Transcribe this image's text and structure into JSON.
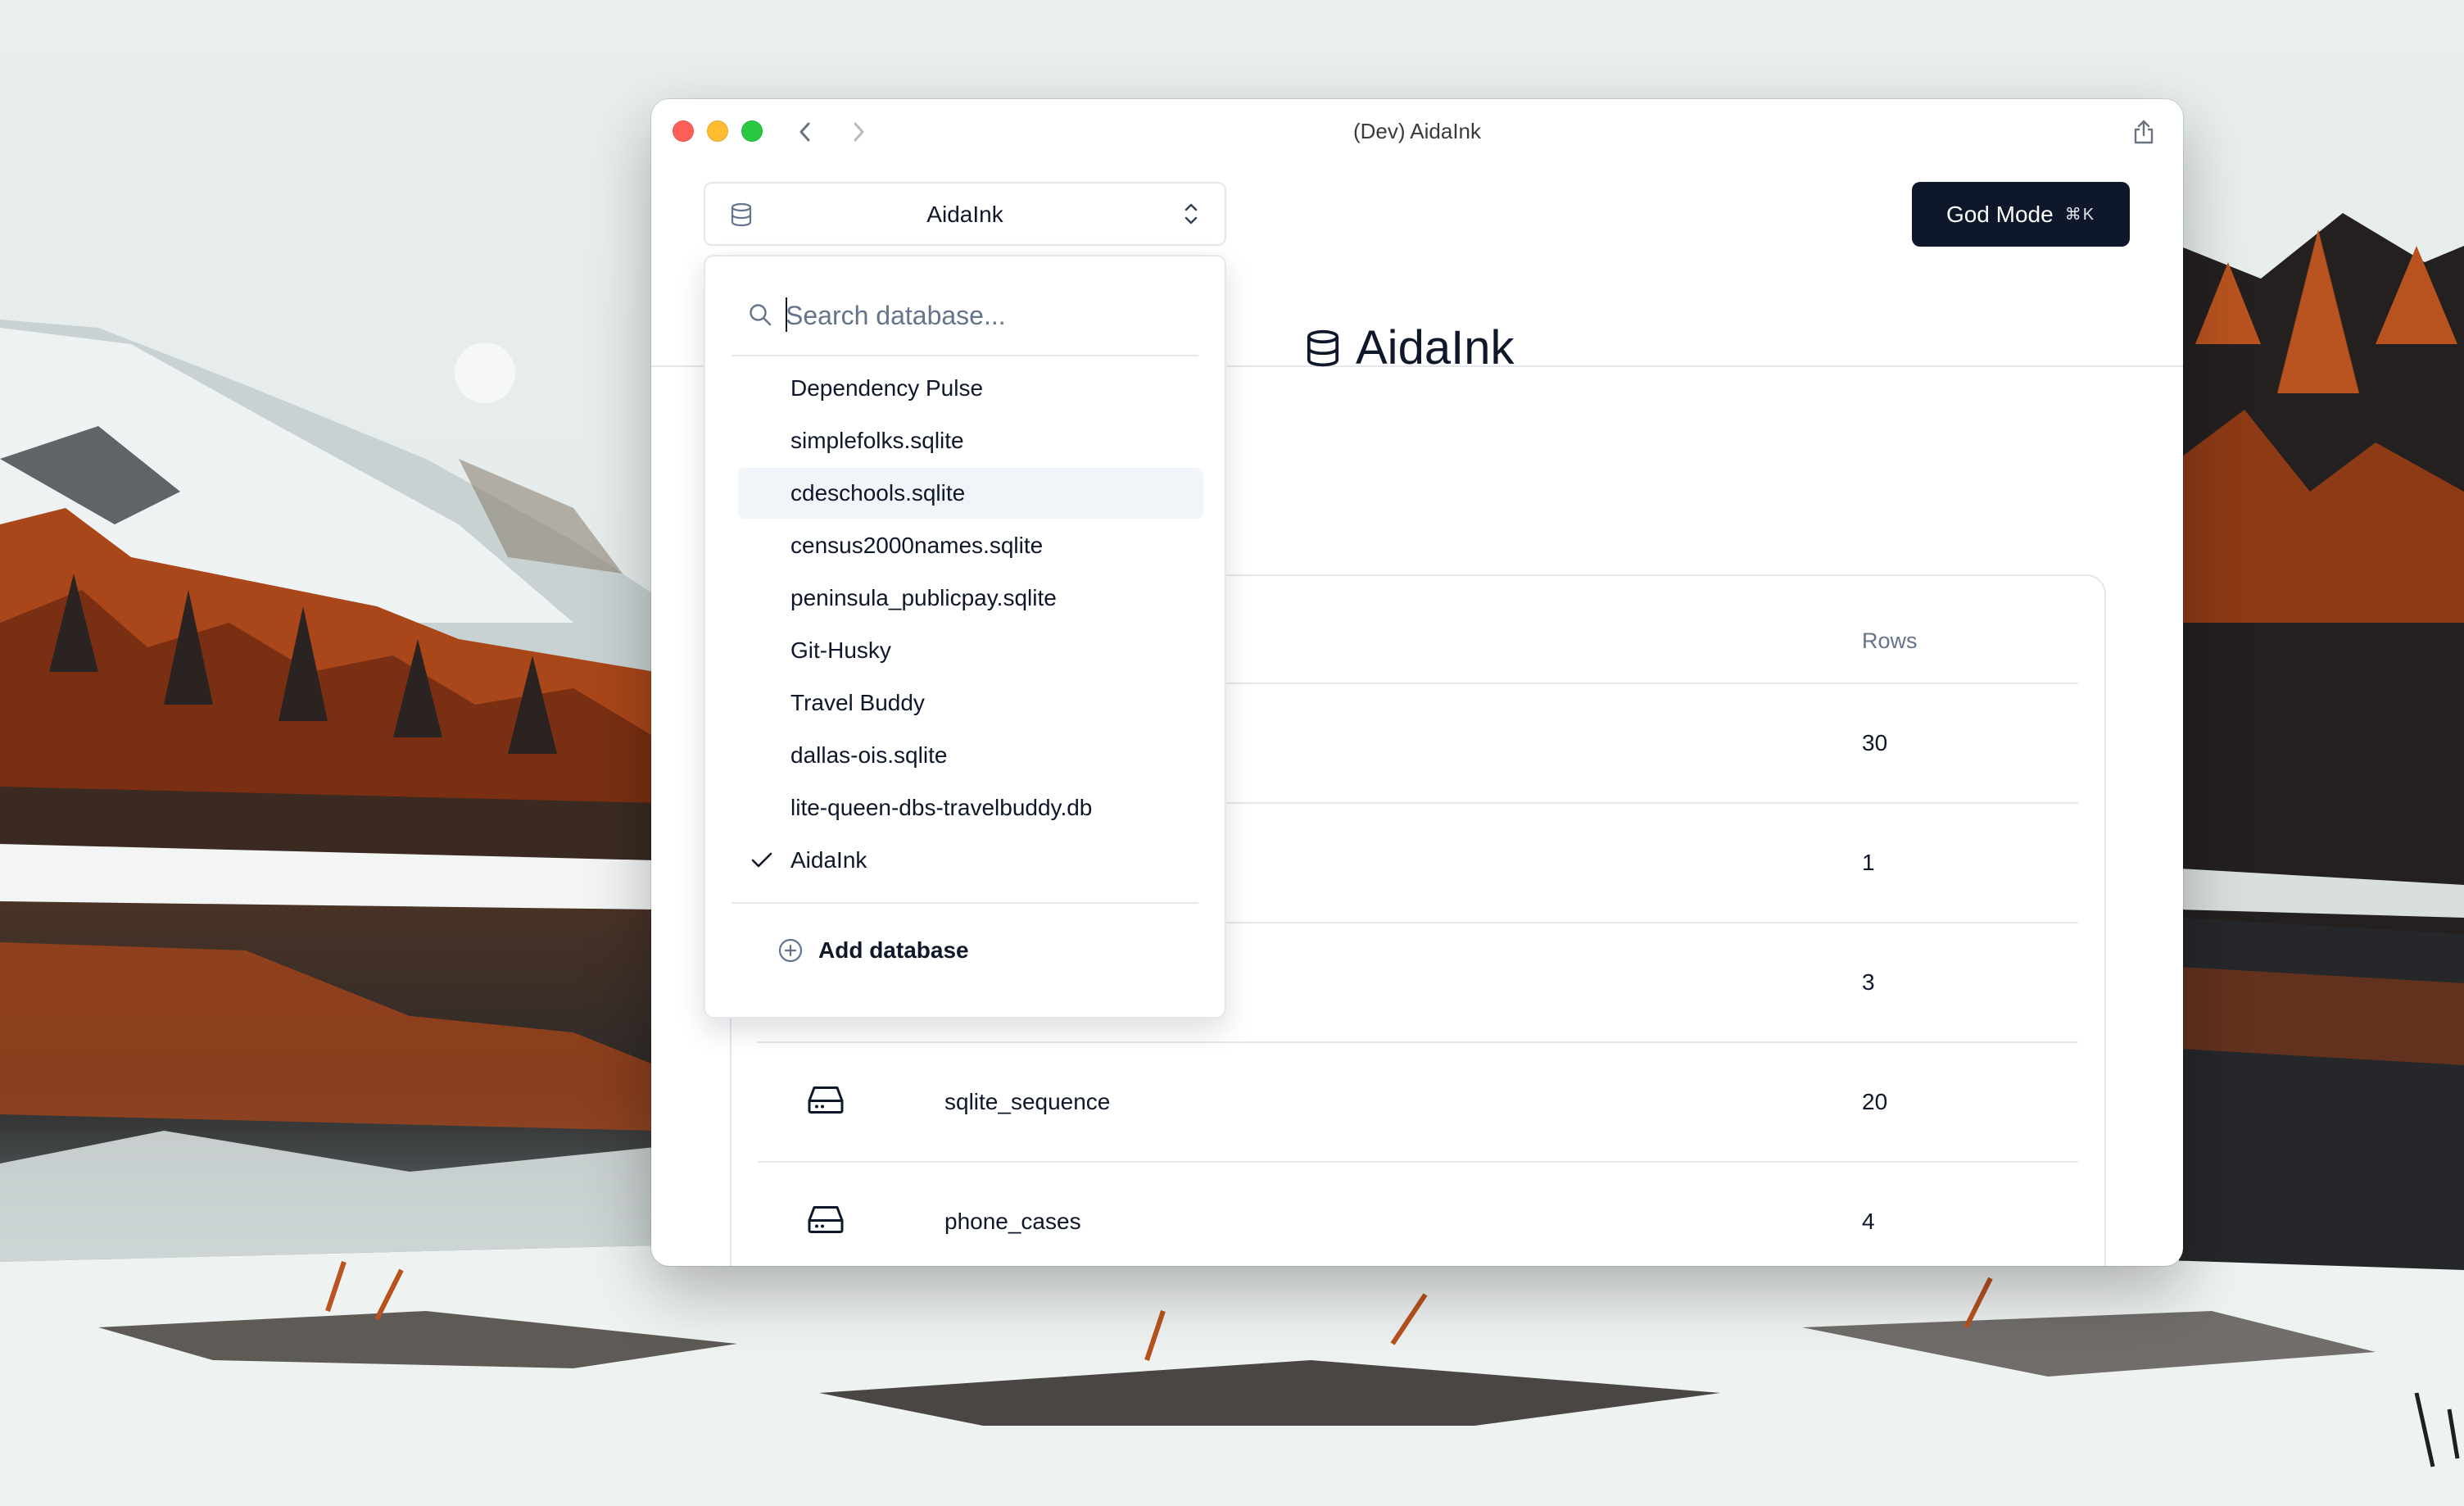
{
  "window": {
    "title": "(Dev) AidaInk"
  },
  "selector": {
    "current": "AidaInk",
    "icon": "database-icon"
  },
  "god_mode": {
    "label": "God Mode",
    "shortcut": "⌘K"
  },
  "page": {
    "title": "AidaInk"
  },
  "tables": {
    "rows_header": "Rows",
    "rows": [
      {
        "name": "",
        "count": "30"
      },
      {
        "name": "",
        "count": "1"
      },
      {
        "name": "",
        "count": "3"
      },
      {
        "name": "sqlite_sequence",
        "count": "20"
      },
      {
        "name": "phone_cases",
        "count": "4"
      }
    ]
  },
  "dropdown": {
    "search_placeholder": "Search database...",
    "items": [
      {
        "label": "Dependency Pulse",
        "selected": false,
        "highlighted": false
      },
      {
        "label": "simplefolks.sqlite",
        "selected": false,
        "highlighted": false
      },
      {
        "label": "cdeschools.sqlite",
        "selected": false,
        "highlighted": true
      },
      {
        "label": "census2000names.sqlite",
        "selected": false,
        "highlighted": false
      },
      {
        "label": "peninsula_publicpay.sqlite",
        "selected": false,
        "highlighted": false
      },
      {
        "label": "Git-Husky",
        "selected": false,
        "highlighted": false
      },
      {
        "label": "Travel Buddy",
        "selected": false,
        "highlighted": false
      },
      {
        "label": "dallas-ois.sqlite",
        "selected": false,
        "highlighted": false
      },
      {
        "label": "lite-queen-dbs-travelbuddy.db",
        "selected": false,
        "highlighted": false
      },
      {
        "label": "AidaInk",
        "selected": true,
        "highlighted": false
      }
    ],
    "add_label": "Add database"
  },
  "colors": {
    "primary": "#0f172a",
    "border": "#e5e7eb",
    "muted": "#64748b",
    "highlight": "#f1f5f9",
    "close": "#fe5f57",
    "minimize": "#febc2e",
    "maximize": "#28c840"
  }
}
